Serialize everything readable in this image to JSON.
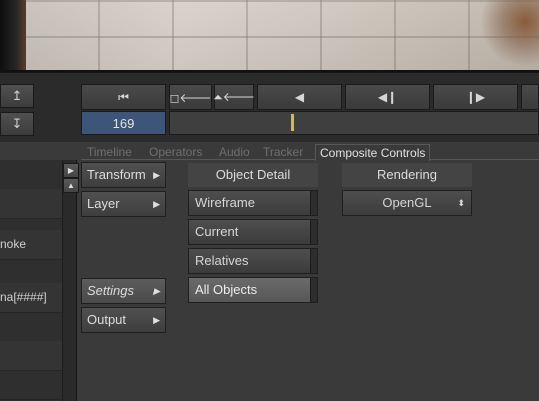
{
  "viewport": {},
  "transport": {
    "buttons": [
      {
        "name": "go-to-start-button",
        "glyph": "⏮"
      },
      {
        "name": "step-back-key-button",
        "glyph": "◻🡐"
      },
      {
        "name": "prev-keyframe-button",
        "glyph": "⏶🡐"
      },
      {
        "name": "play-reverse-button",
        "glyph": "◀"
      },
      {
        "name": "step-back-button",
        "glyph": "◀❙"
      },
      {
        "name": "step-forward-button",
        "glyph": "❙▶"
      }
    ],
    "current_frame": "169"
  },
  "side_buttons": {
    "up_icon": "↥",
    "down_icon": "↧"
  },
  "tabs": [
    "Timeline",
    "Operators",
    "Audio",
    "Tracker",
    "Composite Controls"
  ],
  "active_tab": "Composite Controls",
  "left_list": {
    "rows": [
      "",
      "",
      "",
      "noke",
      "",
      "na[####]",
      "",
      "",
      ""
    ]
  },
  "menu": {
    "transform": "Transform",
    "layer": "Layer",
    "settings": "Settings",
    "output": "Output",
    "arrow": "▶"
  },
  "object_detail": {
    "header": "Object Detail",
    "options": [
      "Wireframe",
      "Current",
      "Relatives",
      "All Objects"
    ],
    "selected": "All Objects"
  },
  "rendering": {
    "header": "Rendering",
    "value": "OpenGL",
    "updown_glyph": "⬍"
  },
  "colors": {
    "accent_frame_field": "#3c5578",
    "playhead": "#d8b84a"
  }
}
